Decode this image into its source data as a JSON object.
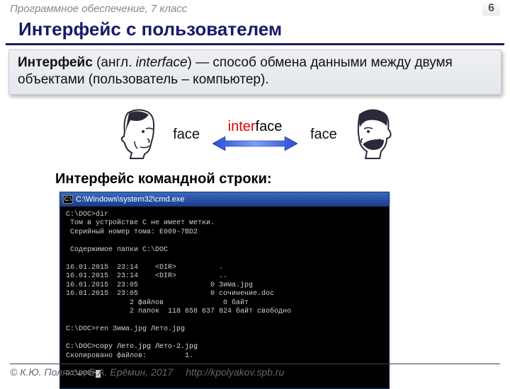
{
  "header": {
    "topic": "Программное обеспечение, 7 класс",
    "page_number": "6"
  },
  "title": "Интерфейс с пользователем",
  "definition": {
    "term": "Интерфейс",
    "paren_prefix": " (англ. ",
    "english": "interface",
    "paren_suffix": ") — способ обмена данными между двумя объектами (пользователь – компьютер)."
  },
  "diagram": {
    "left_label": "face",
    "right_label": "face",
    "center_red": "inter",
    "center_black": "face"
  },
  "subtitle": "Интерфейс командной строки:",
  "cmd": {
    "title": "C:\\Windows\\system32\\cmd.exe",
    "lines": [
      "C:\\DOC>dir",
      " Том в устройстве C не имеет метки.",
      " Серийный номер тома: E009-7BD2",
      "",
      " Содержимое папки C:\\DOC",
      "",
      "16.01.2015  23:14    <DIR>          .",
      "16.01.2015  23:14    <DIR>          ..",
      "16.01.2015  23:05                 0 Зима.jpg",
      "16.01.2015  23:05                 0 сочинение.doc",
      "               2 файлов              0 байт",
      "               2 папок  118 658 637 824 байт свободно",
      "",
      "C:\\DOC>ren Зима.jpg Лето.jpg",
      "",
      "C:\\DOC>copy Лето.jpg Лето-2.jpg",
      "Скопировано файлов:         1.",
      "",
      "C:\\DOC>"
    ]
  },
  "footer": {
    "copyright": "© К.Ю. Поляков, Е.А. Ерёмин, 2017",
    "url": "http://kpolyakov.spb.ru"
  }
}
